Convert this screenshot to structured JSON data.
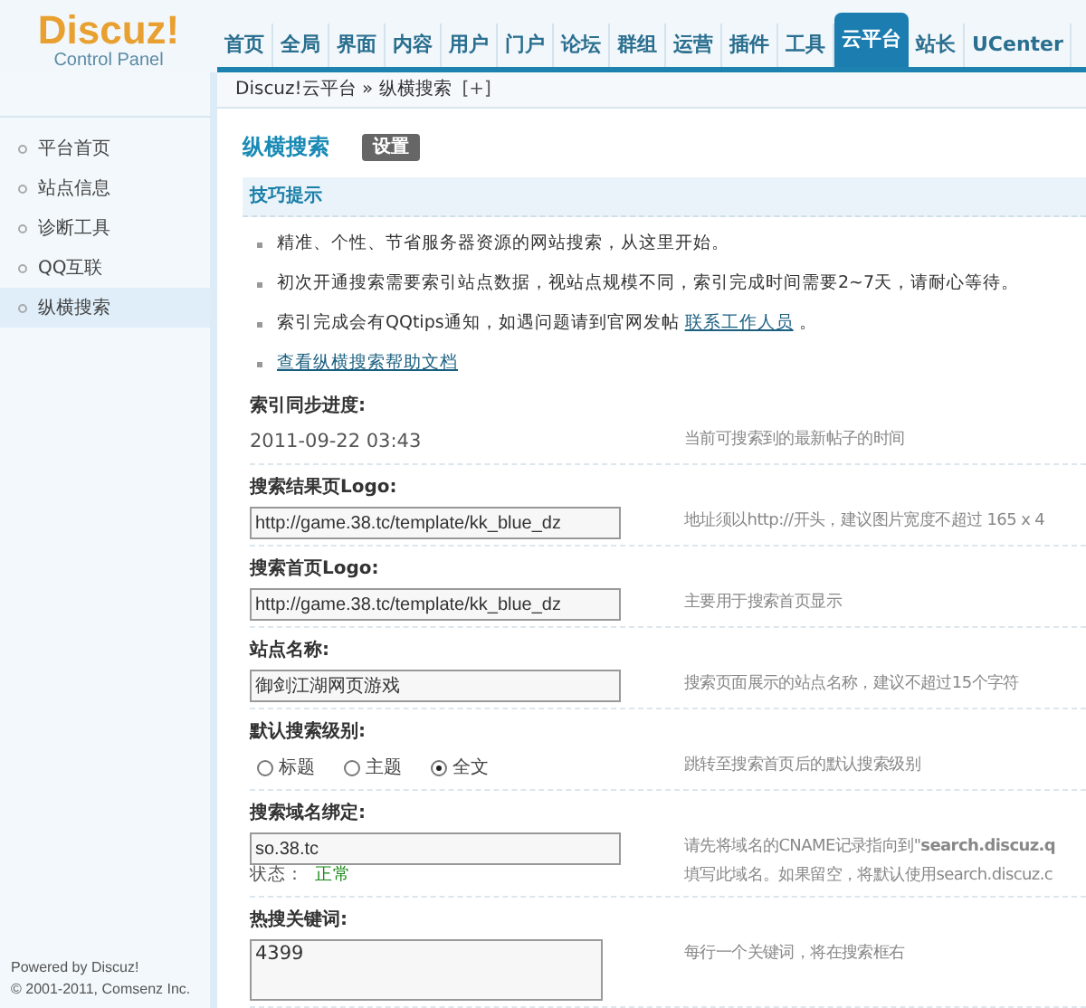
{
  "header": {
    "logo": "Discuz!",
    "subtitle": "Control Panel",
    "nav": [
      {
        "label": "首页",
        "selected": false
      },
      {
        "label": "全局",
        "selected": false
      },
      {
        "label": "界面",
        "selected": false
      },
      {
        "label": "内容",
        "selected": false
      },
      {
        "label": "用户",
        "selected": false
      },
      {
        "label": "门户",
        "selected": false
      },
      {
        "label": "论坛",
        "selected": false
      },
      {
        "label": "群组",
        "selected": false
      },
      {
        "label": "运营",
        "selected": false
      },
      {
        "label": "插件",
        "selected": false
      },
      {
        "label": "工具",
        "selected": false
      },
      {
        "label": "云平台",
        "selected": true
      },
      {
        "label": "站长",
        "selected": false
      },
      {
        "label": "UCenter",
        "selected": false
      }
    ]
  },
  "breadcrumb": {
    "path": "Discuz!云平台 » 纵横搜索",
    "add": "[+]"
  },
  "sidebar": {
    "items": [
      {
        "label": "平台首页",
        "selected": false
      },
      {
        "label": "站点信息",
        "selected": false
      },
      {
        "label": "诊断工具",
        "selected": false
      },
      {
        "label": "QQ互联",
        "selected": false
      },
      {
        "label": "纵横搜索",
        "selected": true
      }
    ],
    "footer": [
      "Powered by Discuz!",
      "© 2001-2011, Comsenz Inc."
    ]
  },
  "page": {
    "title": "纵横搜索",
    "tab": "设置"
  },
  "tips": {
    "title": "技巧提示",
    "items": [
      {
        "text": "精准、个性、节省服务器资源的网站搜索，从这里开始。"
      },
      {
        "text": "初次开通搜索需要索引站点数据，视站点规模不同，索引完成时间需要2~7天，请耐心等待。"
      },
      {
        "text": "索引完成会有QQtips通知，如遇问题请到官网发帖",
        "link": "联系工作人员",
        "after": "。"
      },
      {
        "link": "查看纵横搜索帮助文档"
      }
    ]
  },
  "settings": [
    {
      "kind": "text",
      "label": "索引同步进度:",
      "value": "2011-09-22 03:43",
      "hint": [
        "当前可搜索到的最新帖子的时间"
      ]
    },
    {
      "kind": "input",
      "label": "搜索结果页Logo:",
      "value": "http://game.38.tc/template/kk_blue_dz",
      "hint": [
        "地址须以http://开头，建议图片宽度不超过 165 x 4"
      ]
    },
    {
      "kind": "input",
      "label": "搜索首页Logo:",
      "value": "http://game.38.tc/template/kk_blue_dz",
      "hint": [
        "主要用于搜索首页显示"
      ]
    },
    {
      "kind": "input",
      "label": "站点名称:",
      "value": "御剑江湖网页游戏",
      "hint": [
        "搜索页面展示的站点名称，建议不超过15个字符"
      ]
    },
    {
      "kind": "radio",
      "label": "默认搜索级别:",
      "options": [
        {
          "label": "标题",
          "selected": false
        },
        {
          "label": "主题",
          "selected": false
        },
        {
          "label": "全文",
          "selected": true
        }
      ],
      "hint": [
        "跳转至搜索首页后的默认搜索级别"
      ]
    },
    {
      "kind": "input",
      "label": "搜索域名绑定:",
      "value": "so.38.tc",
      "status_label": "状态：",
      "status": "正常",
      "hint": [
        "请先将域名的CNAME记录指向到\"**search.discuz.q**",
        "填写此域名。如果留空，将默认使用search.discuz.c"
      ]
    },
    {
      "kind": "textarea",
      "label": "热搜关键词:",
      "value": "4399",
      "hint": [
        "每行一个关键词，将在搜索框右"
      ]
    }
  ]
}
